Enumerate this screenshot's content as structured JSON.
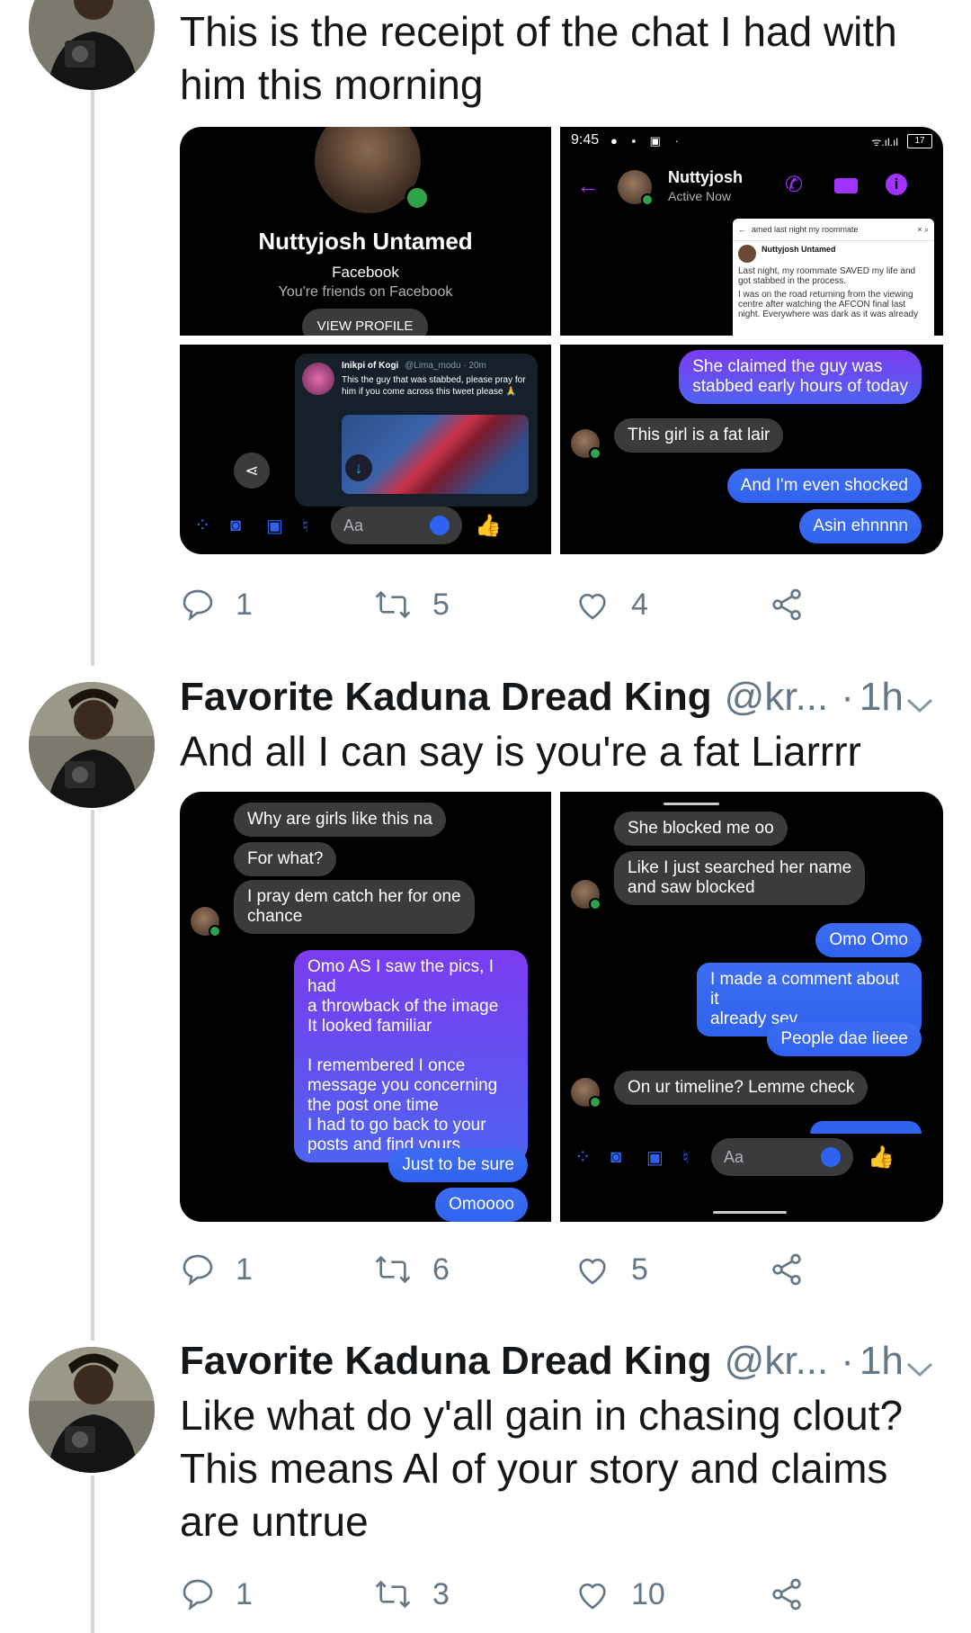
{
  "tweets": [
    {
      "text": "This is the receipt of the chat I had with\nhim this morning",
      "stats": {
        "replies": "1",
        "retweets": "5",
        "likes": "4"
      }
    },
    {
      "name": "Favorite Kaduna Dread King",
      "handle": "@kr...",
      "dot": "·",
      "time": "1h",
      "text": "And all I can say is you're a fat Liarrrr",
      "stats": {
        "replies": "1",
        "retweets": "6",
        "likes": "5"
      }
    },
    {
      "name": "Favorite Kaduna Dread King",
      "handle": "@kr...",
      "dot": "·",
      "time": "1h",
      "text": "Like what do y'all gain in chasing clout?\nThis means Al of your story and claims\nare untrue",
      "stats": {
        "replies": "1",
        "retweets": "3",
        "likes": "10"
      }
    }
  ],
  "shot1": {
    "profile_name": "Nuttyjosh Untamed",
    "network": "Facebook",
    "friends": "You're friends on Facebook",
    "view_profile": "VIEW PROFILE"
  },
  "shot2": {
    "clock": "9:45",
    "battery": "17",
    "contact": "Nuttyjosh",
    "presence": "Active Now",
    "search_text": "amed last night my roommate",
    "post_author": "Nuttyjosh Untamed",
    "post_line1": "Last night, my roommate SAVED my life and got stabbed in the process.",
    "post_line2": "I was on the road returning from the viewing centre after watching the AFCON final last night. Everywhere was dark as it was already"
  },
  "shot3": {
    "tweet_author": "Inikpi of Kogi",
    "tweet_meta": "@Lima_modu · 20m",
    "tweet_body": "This the guy that was stabbed, please pray for him if you come across this tweet please 🙏",
    "composer_placeholder": "Aa"
  },
  "shot4": {
    "msgs": [
      "She claimed the guy was\nstabbed early hours of today",
      "This girl is a fat lair",
      "And I'm even shocked",
      "Asin ehnnnn"
    ]
  },
  "shot5": {
    "msgs": [
      "Why are girls like this na",
      "For what?",
      "I pray dem catch her for one\nchance",
      "Omo AS I saw the pics, I had\na throwback of the image\nIt looked familiar\n\nI remembered I once\nmessage you concerning\nthe post one time\nI had to go back to your\nposts and find yours",
      "Just to be sure",
      "Omoooo"
    ]
  },
  "shot6": {
    "msgs": [
      "She blocked me oo",
      "Like I just searched her name\nand saw blocked",
      "Omo Omo",
      "I made a comment about it\nalready sev",
      "People dae lieee",
      "On ur timeline? Lemme check"
    ],
    "composer_placeholder": "Aa"
  },
  "colors": {
    "twitter_grey": "#657786",
    "messenger_blue": "#2f62ef",
    "messenger_purple": "#a033ff"
  }
}
